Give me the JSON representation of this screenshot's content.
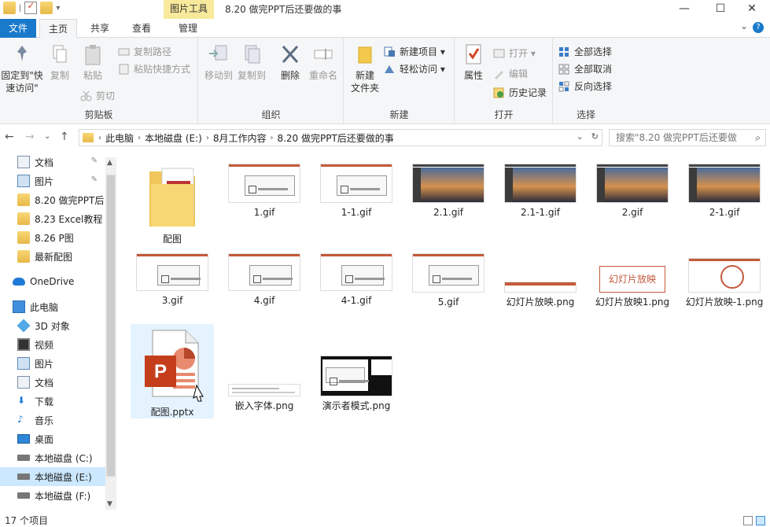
{
  "window": {
    "title": "8.20 做完PPT后还要做的事",
    "contextual_tab": "图片工具",
    "controls": {
      "minimize": "—",
      "maximize": "☐",
      "close": "✕"
    }
  },
  "ribbon_tabs": [
    {
      "label": "文件"
    },
    {
      "label": "主页"
    },
    {
      "label": "共享"
    },
    {
      "label": "查看"
    },
    {
      "label": "管理"
    }
  ],
  "ribbon": {
    "clipboard": {
      "label": "剪贴板",
      "pin": "固定到\"快速访问\"",
      "copy": "复制",
      "paste": "粘贴",
      "copy_path": "复制路径",
      "paste_shortcut": "粘贴快捷方式",
      "cut": "剪切"
    },
    "organize": {
      "label": "组织",
      "move_to": "移动到",
      "copy_to": "复制到",
      "delete": "删除",
      "rename": "重命名"
    },
    "new": {
      "label": "新建",
      "new_folder": "新建\n文件夹",
      "new_item": "新建项目",
      "easy_access": "轻松访问"
    },
    "open": {
      "label": "打开",
      "properties": "属性",
      "open": "打开",
      "edit": "编辑",
      "history": "历史记录"
    },
    "select": {
      "label": "选择",
      "select_all": "全部选择",
      "select_none": "全部取消",
      "invert": "反向选择"
    }
  },
  "address": {
    "crumbs": [
      "此电脑",
      "本地磁盘 (E:)",
      "8月工作内容",
      "8.20 做完PPT后还要做的事"
    ],
    "search_placeholder": "搜索\"8.20 做完PPT后还要做"
  },
  "sidebar": {
    "items": [
      {
        "label": "文档",
        "pinned": true
      },
      {
        "label": "图片",
        "pinned": true
      },
      {
        "label": "8.20 做完PPT后"
      },
      {
        "label": "8.23 Excel教程"
      },
      {
        "label": "8.26 P图"
      },
      {
        "label": "最新配图"
      },
      {
        "label": "OneDrive"
      },
      {
        "label": "此电脑"
      },
      {
        "label": "3D 对象"
      },
      {
        "label": "视频"
      },
      {
        "label": "图片"
      },
      {
        "label": "文档"
      },
      {
        "label": "下载"
      },
      {
        "label": "音乐"
      },
      {
        "label": "桌面"
      },
      {
        "label": "本地磁盘 (C:)"
      },
      {
        "label": "本地磁盘 (E:)"
      },
      {
        "label": "本地磁盘 (F:)"
      }
    ]
  },
  "files": [
    {
      "name": "配图",
      "kind": "folder"
    },
    {
      "name": "1.gif",
      "kind": "dialog"
    },
    {
      "name": "1-1.gif",
      "kind": "dialog"
    },
    {
      "name": "2.1.gif",
      "kind": "photo"
    },
    {
      "name": "2.1-1.gif",
      "kind": "photo"
    },
    {
      "name": "2.gif",
      "kind": "photo"
    },
    {
      "name": "2-1.gif",
      "kind": "photo"
    },
    {
      "name": "3.gif",
      "kind": "slide"
    },
    {
      "name": "4.gif",
      "kind": "slide"
    },
    {
      "name": "4-1.gif",
      "kind": "slide"
    },
    {
      "name": "5.gif",
      "kind": "dialog"
    },
    {
      "name": "幻灯片放映.png",
      "kind": "strip"
    },
    {
      "name": "幻灯片放映1.png",
      "kind": "button",
      "button_text": "幻灯片放映"
    },
    {
      "name": "幻灯片放映-1.png",
      "kind": "circle"
    },
    {
      "name": "配图.pptx",
      "kind": "pptx"
    },
    {
      "name": "嵌入字体.png",
      "kind": "text"
    },
    {
      "name": "演示者模式.png",
      "kind": "dark"
    }
  ],
  "status": {
    "count": "17 个项目"
  }
}
